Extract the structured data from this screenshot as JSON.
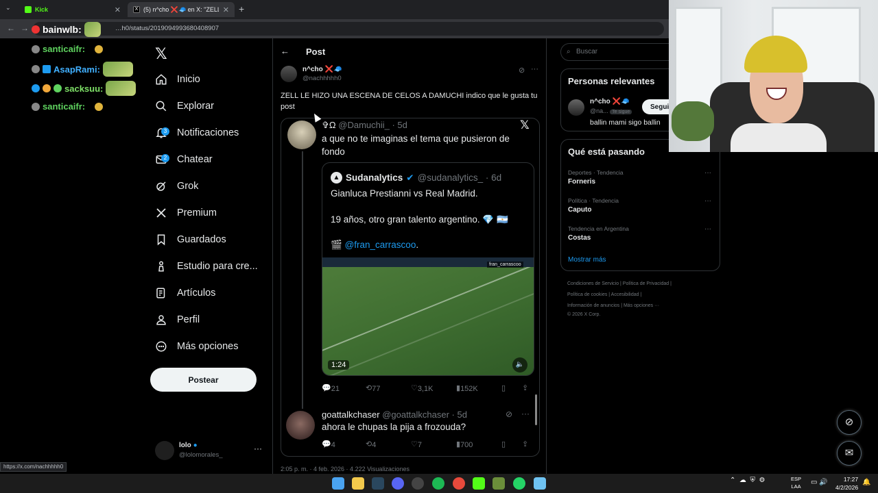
{
  "browser": {
    "tabs": [
      {
        "label": "Kick"
      },
      {
        "label": "(5) n^cho ❌🧢 en X: \"ZELL LE"
      }
    ],
    "new_tab": "+",
    "url": "…h0/status/2019094993680408907",
    "status_url": "https://x.com/nachhhhh0"
  },
  "chat": {
    "messages": [
      {
        "user": "santicaifr:",
        "color": "#5fd35f"
      },
      {
        "user": "AsapRami:",
        "color": "#41b0ff"
      },
      {
        "user": "sacksuu:",
        "color": "#7ee067"
      },
      {
        "user": "santicaifr:",
        "color": "#5fd35f"
      }
    ],
    "overlay_user": "bainwlb:"
  },
  "sidebar": {
    "logo": "𝕏",
    "items": [
      {
        "label": "Inicio",
        "icon": "home-icon"
      },
      {
        "label": "Explorar",
        "icon": "search-icon"
      },
      {
        "label": "Notificaciones",
        "icon": "bell-icon",
        "badge": "3"
      },
      {
        "label": "Chatear",
        "icon": "mail-icon",
        "badge": "2"
      },
      {
        "label": "Grok",
        "icon": "grok-icon"
      },
      {
        "label": "Premium",
        "icon": "x-icon"
      },
      {
        "label": "Guardados",
        "icon": "bookmark-icon"
      },
      {
        "label": "Estudio para cre...",
        "icon": "studio-icon"
      },
      {
        "label": "Artículos",
        "icon": "article-icon"
      },
      {
        "label": "Perfil",
        "icon": "person-icon"
      },
      {
        "label": "Más opciones",
        "icon": "more-circle-icon"
      }
    ],
    "post_button": "Postear",
    "account": {
      "name": "lolo",
      "handle": "@lolomorales_",
      "more": "···"
    }
  },
  "post": {
    "header_title": "Post",
    "author_name": "n^cho ❌🧢",
    "author_handle": "@nachhhhh0",
    "text": "ZELL LE HIZO UNA ESCENA DE CELOS A DAMUCHI indico que le gusta tu post",
    "quote": {
      "author": "✞Ω",
      "handle_time": "@Damuchii_ · 5d",
      "text": "a que no te imaginas el tema que pusieron de fondo",
      "inner": {
        "name": "Sudanalytics",
        "handle_time": "@sudanalytics_ · 6d",
        "line1": "Gianluca Prestianni vs Real Madrid.",
        "line2": "19 años, otro gran talento argentino. 💎 🇦🇷",
        "line3_prefix": "🎬",
        "line3_link": "@fran_carrascoo",
        "line3_suffix": ".",
        "video_duration": "1:24",
        "video_tag": "fran_carrascoo"
      },
      "actions": {
        "replies": "21",
        "reposts": "77",
        "likes": "3,1K",
        "views": "152K"
      }
    },
    "reply": {
      "name": "goattalkchaser",
      "handle_time": "@goattalkchaser · 5d",
      "text": "ahora le chupas la pija a frozouda?",
      "actions": {
        "replies": "4",
        "reposts": "4",
        "likes": "7",
        "views": "700"
      }
    },
    "timeline": "2:05 p. m. · 4 feb. 2026 · 4.222 Visualizaciones"
  },
  "right": {
    "search_placeholder": "Buscar",
    "relevant_title": "Personas relevantes",
    "relevant": {
      "name": "n^cho ❌🧢",
      "handle": "@na...",
      "follows_you": "Te sigue",
      "follow_button": "Seguir",
      "bio": "ballin mami sigo ballin"
    },
    "trending_title": "Qué está pasando",
    "trends": [
      {
        "category": "Deportes · Tendencia",
        "name": "Forneris"
      },
      {
        "category": "Política · Tendencia",
        "name": "Caputo"
      },
      {
        "category": "Tendencia en Argentina",
        "name": "Costas"
      }
    ],
    "show_more": "Mostrar más",
    "footer": [
      "Condiciones de Servicio  |  Política de Privacidad  |",
      "Política de cookies  |  Accesibilidad  |",
      "Información de anuncios  |  Más opciones ···",
      "© 2026 X Corp."
    ]
  },
  "taskbar": {
    "lang_top": "ESP",
    "lang_bottom": "LAA",
    "time": "17:27",
    "date": "4/2/2026"
  }
}
